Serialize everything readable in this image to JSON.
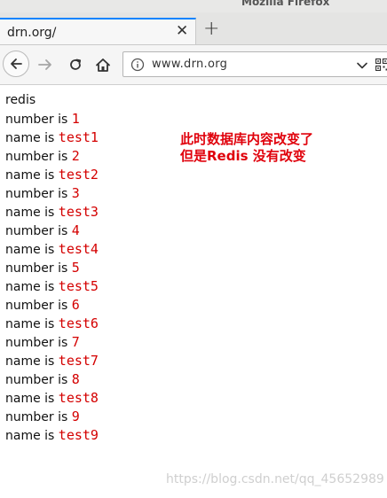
{
  "window": {
    "title": "Mozilla Firefox"
  },
  "tab": {
    "label": "drn.org/",
    "close_glyph": "✕",
    "new_tab_glyph": "+"
  },
  "toolbar": {
    "url": "www.drn.org",
    "icons": [
      "back-arrow-icon",
      "forward-arrow-icon",
      "reload-icon",
      "home-icon",
      "info-icon",
      "chevron-down-icon",
      "qr-code-icon"
    ]
  },
  "page": {
    "heading": "redis",
    "records": [
      {
        "number_label": "number is ",
        "number": "1",
        "name_label": "name is ",
        "name": "test1"
      },
      {
        "number_label": "number is ",
        "number": "2",
        "name_label": "name is ",
        "name": "test2"
      },
      {
        "number_label": "number is ",
        "number": "3",
        "name_label": "name is ",
        "name": "test3"
      },
      {
        "number_label": "number is ",
        "number": "4",
        "name_label": "name is ",
        "name": "test4"
      },
      {
        "number_label": "number is ",
        "number": "5",
        "name_label": "name is ",
        "name": "test5"
      },
      {
        "number_label": "number is ",
        "number": "6",
        "name_label": "name is ",
        "name": "test6"
      },
      {
        "number_label": "number is ",
        "number": "7",
        "name_label": "name is ",
        "name": "test7"
      },
      {
        "number_label": "number is ",
        "number": "8",
        "name_label": "name is ",
        "name": "test8"
      },
      {
        "number_label": "number is ",
        "number": "9",
        "name_label": "name is ",
        "name": "test9"
      }
    ],
    "annotation": [
      "此时数据库内容改变了",
      "但是Redis 没有改变"
    ]
  },
  "watermark": "https://blog.csdn.net/qq_45652989",
  "colors": {
    "value_red": "#d40000",
    "annotation_red": "#e0000b",
    "tab_accent": "#0a84ff"
  }
}
